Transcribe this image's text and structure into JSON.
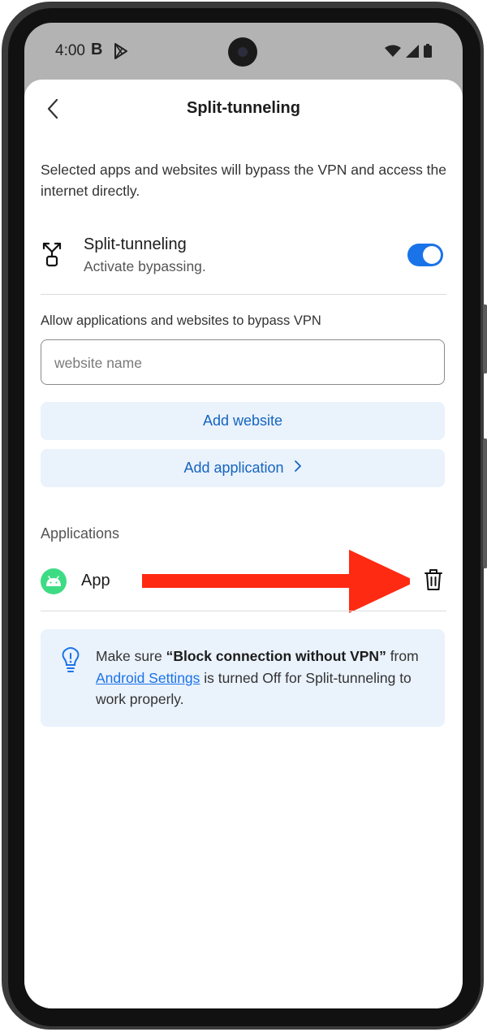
{
  "status_bar": {
    "time": "4:00",
    "notification_letter": "B",
    "icons": [
      "play-store-icon",
      "wifi-icon",
      "signal-icon",
      "battery-icon"
    ]
  },
  "header": {
    "title": "Split-tunneling",
    "back_icon": "chevron-left-icon"
  },
  "description": "Selected apps and websites will bypass the VPN and access the internet directly.",
  "split_tunneling": {
    "icon": "split-arrows-icon",
    "title": "Split-tunneling",
    "subtitle": "Activate bypassing.",
    "enabled": true
  },
  "allow_label": "Allow applications and websites to bypass VPN",
  "website_input": {
    "placeholder": "website name",
    "value": ""
  },
  "add_website_label": "Add website",
  "add_application_label": "Add application",
  "applications_section_label": "Applications",
  "applications": [
    {
      "name": "App",
      "icon": "android-icon"
    }
  ],
  "info": {
    "icon": "lightbulb-icon",
    "prefix": "Make sure ",
    "bold": "“Block connection without VPN”",
    "mid": " from ",
    "link": "Android Settings",
    "suffix": " is turned Off for Split-tunneling to work properly."
  },
  "colors": {
    "accent": "#1a73e8",
    "soft_button_bg": "#eaf2fc",
    "annotation_arrow": "#ff2a12",
    "android_green": "#3ddc84"
  }
}
